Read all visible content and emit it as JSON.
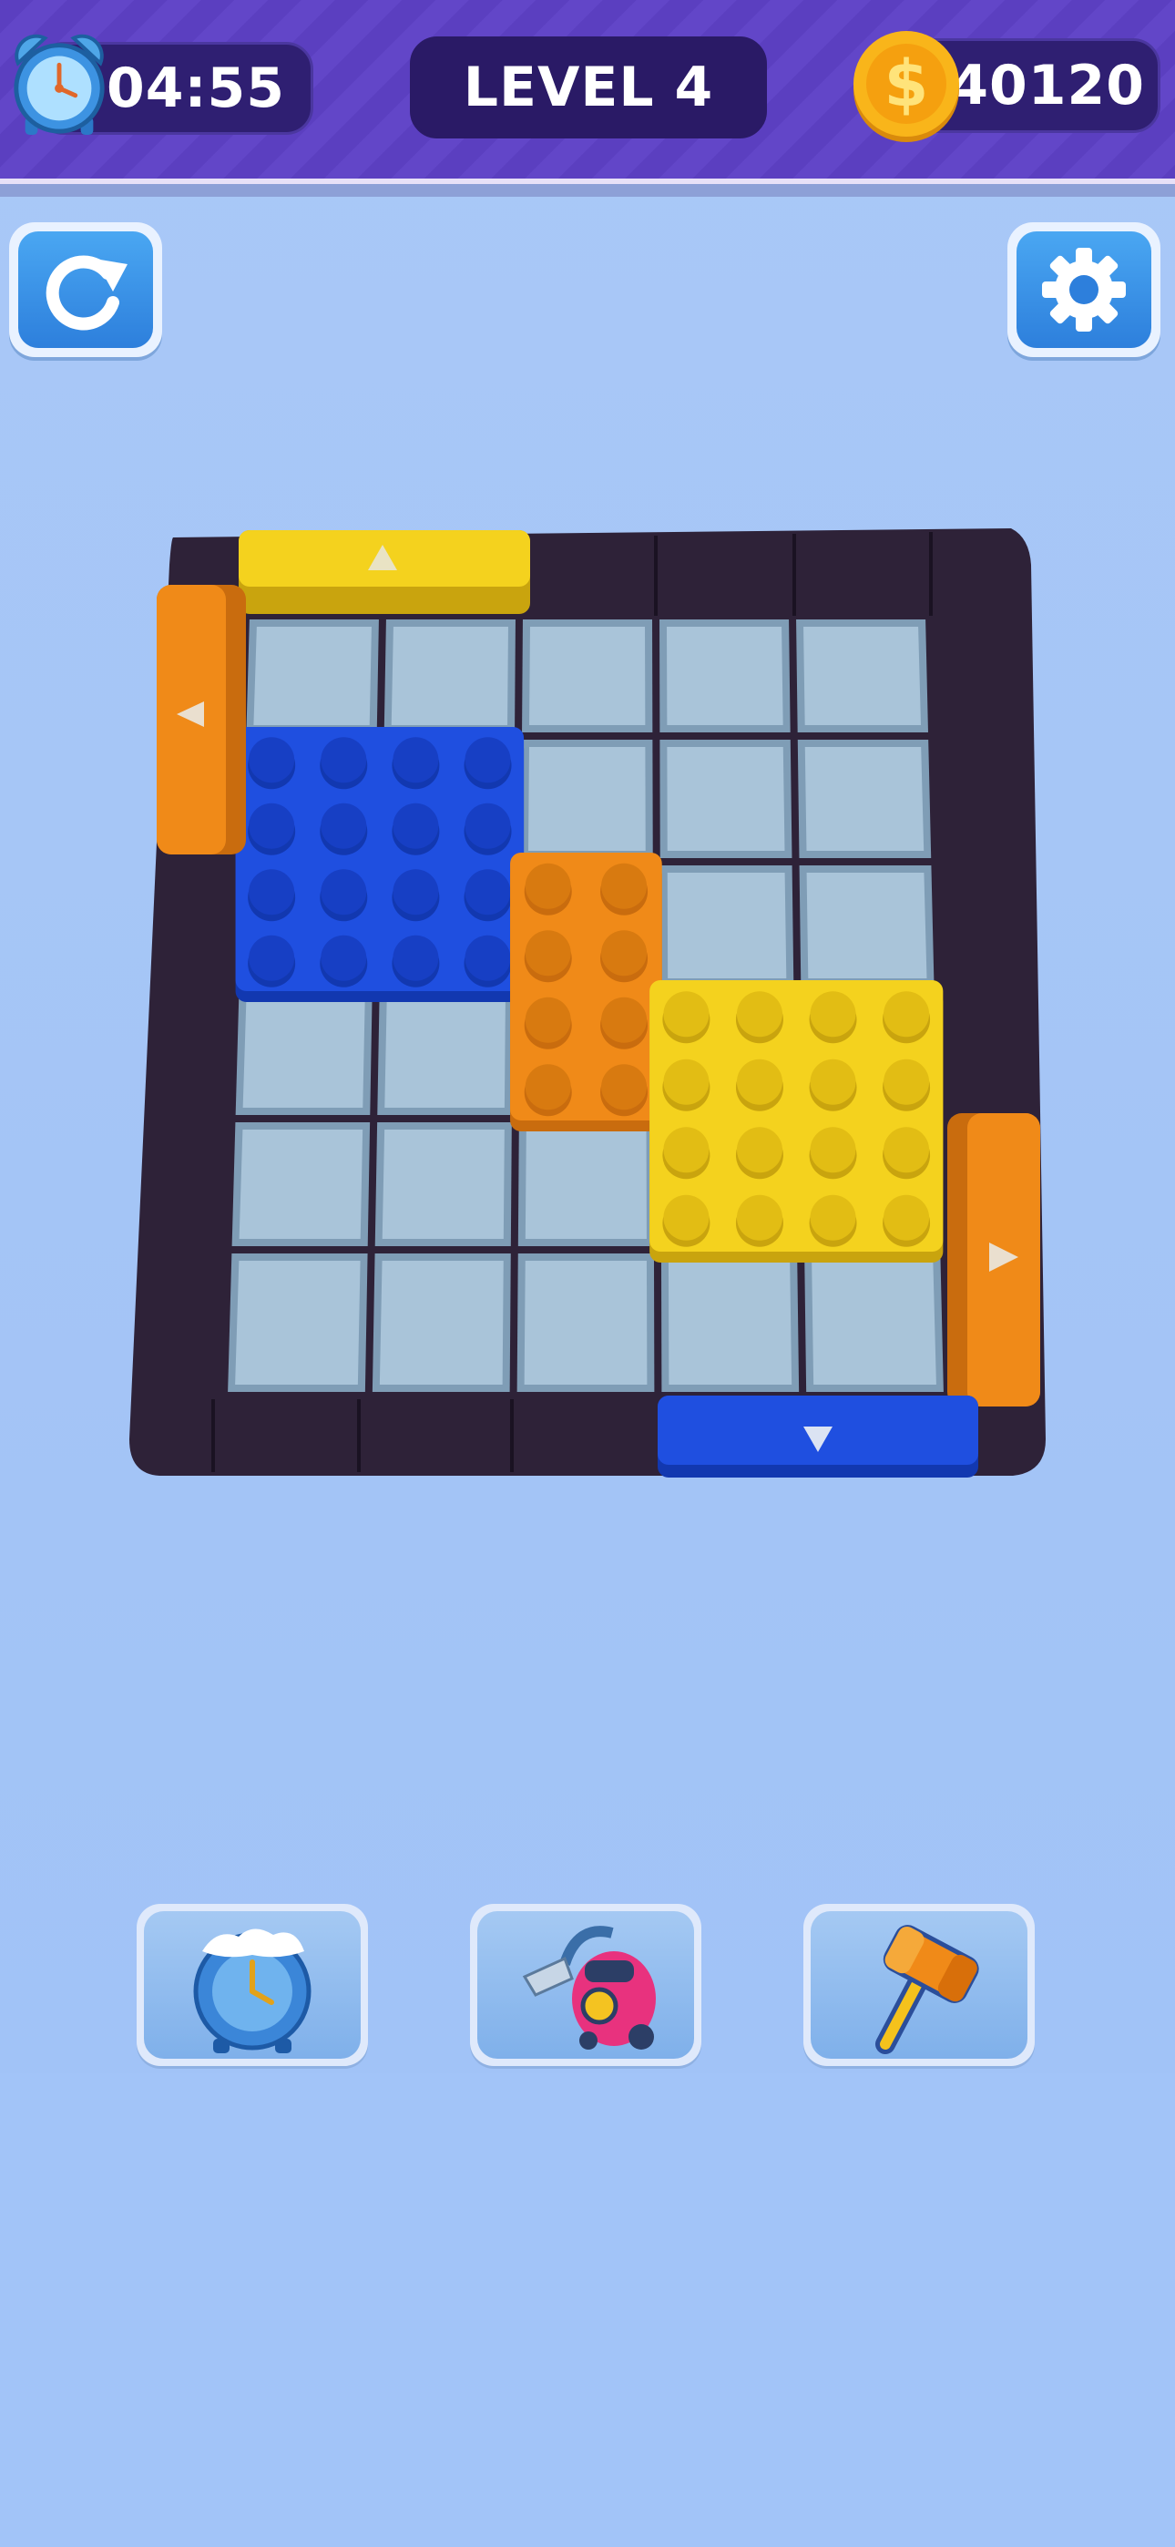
{
  "hud": {
    "timer": "04:55",
    "level": "LEVEL 4",
    "coins": "40120",
    "timer_icon": "alarm-clock-icon",
    "coin_icon": "dollar-coin-icon"
  },
  "controls": {
    "restart_icon": "restart-icon",
    "settings_icon": "gear-icon"
  },
  "board": {
    "grid_cols": 5,
    "grid_rows": 6,
    "frame_color": "#2e2238",
    "tile_color": "#a9c4d9",
    "blocks": [
      {
        "color": "blue",
        "hex": "#1f4fe0",
        "cols": [
          0,
          1
        ],
        "rows": [
          1,
          2
        ]
      },
      {
        "color": "orange",
        "hex": "#f08a18",
        "cols": [
          2
        ],
        "rows": [
          2,
          3
        ]
      },
      {
        "color": "yellow",
        "hex": "#f4d21e",
        "cols": [
          3,
          4
        ],
        "rows": [
          3,
          4
        ]
      }
    ],
    "exit_gates": [
      {
        "color": "yellow",
        "side": "top",
        "arrow": "up-arrow-icon"
      },
      {
        "color": "orange",
        "side": "left",
        "arrow": "left-arrow-icon"
      },
      {
        "color": "orange",
        "side": "right",
        "arrow": "right-arrow-icon"
      },
      {
        "color": "blue",
        "side": "bottom",
        "arrow": "down-arrow-icon"
      }
    ]
  },
  "boosters": [
    {
      "icon": "frozen-clock-icon"
    },
    {
      "icon": "vacuum-cleaner-icon"
    },
    {
      "icon": "hammer-icon"
    }
  ],
  "colors": {
    "topbar": "#5b3fc0",
    "background": "#a3c4f6",
    "button_blue": "#2d7fdc"
  }
}
